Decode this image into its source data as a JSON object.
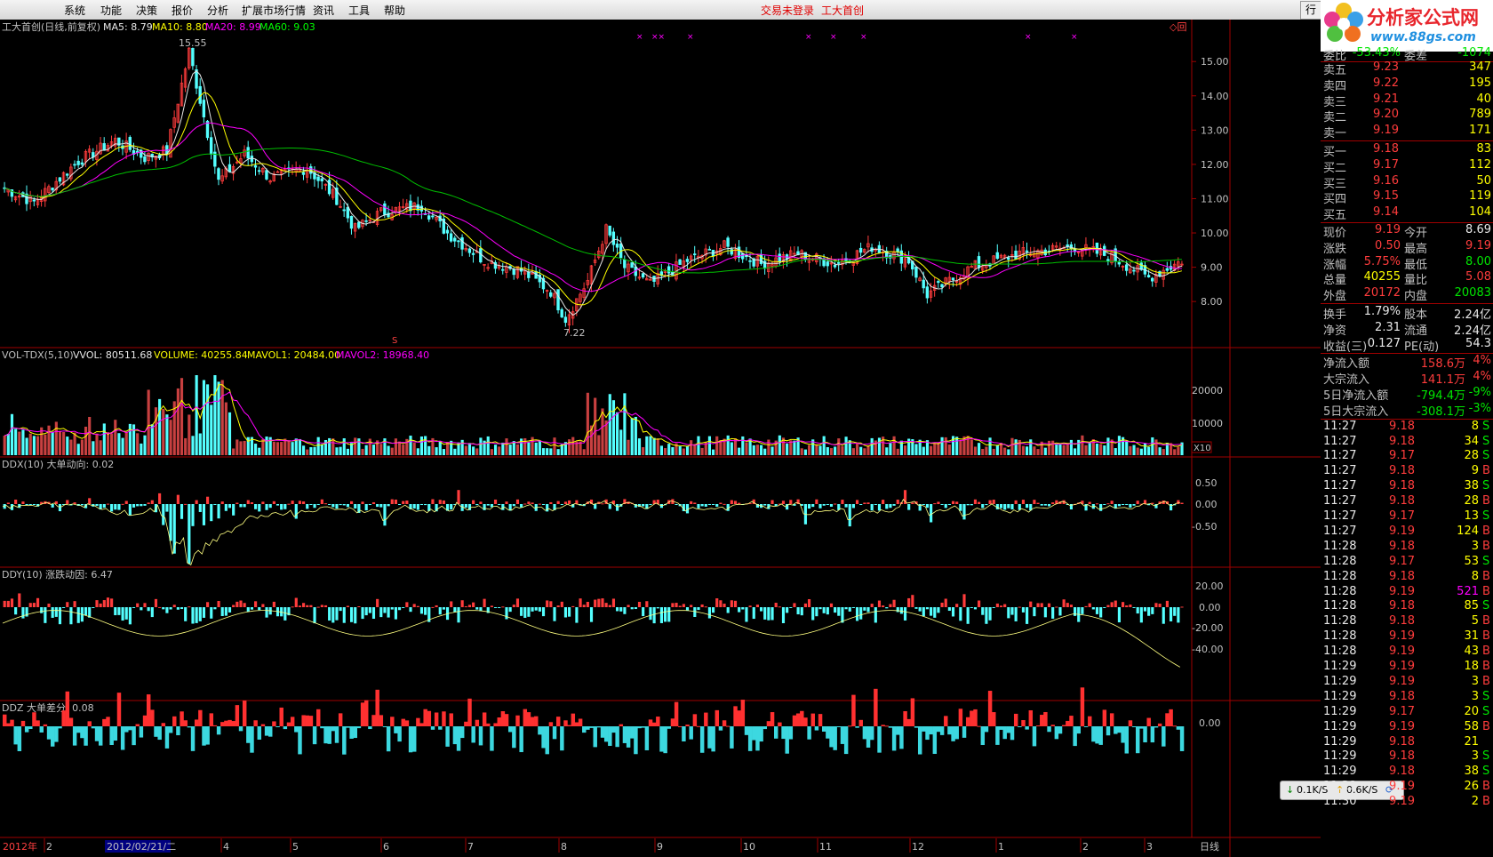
{
  "menu": {
    "items": [
      "系统",
      "功能",
      "决策",
      "报价",
      "分析",
      "扩展市场行情",
      "资讯",
      "工具",
      "帮助"
    ],
    "status": [
      "交易未登录",
      "工大首创"
    ],
    "right_button": "行"
  },
  "logo": {
    "title": "分析家公式网",
    "url": "www.88gs.com"
  },
  "main_panel": {
    "legend": {
      "name": "工大首创(日线,前复权)",
      "ma5": "MA5: 8.79",
      "ma10": "MA10: 8.80",
      "ma20": "MA20: 8.99",
      "ma60": "MA60: 9.03"
    },
    "high_label": "15.55",
    "low_label": "7.22",
    "yticks": [
      "15.00",
      "14.00",
      "13.00",
      "12.00",
      "11.00",
      "10.00",
      "9.00",
      "8.00"
    ]
  },
  "vol_panel": {
    "legend": {
      "name": "VOL-TDX(5,10)",
      "vvol": "VVOL: 80511.68",
      "volume": "VOLUME: 40255.84",
      "mavol1": "MAVOL1: 20484.00",
      "mavol2": "MAVOL2: 18968.40"
    },
    "yticks": [
      "20000",
      "10000"
    ],
    "unit": "X10"
  },
  "ddx_panel": {
    "legend": "DDX(10) 大单动向: 0.02",
    "yticks": [
      "0.50",
      "0.00",
      "-0.50"
    ]
  },
  "ddy_panel": {
    "legend": "DDY(10) 涨跌动因: 6.47",
    "yticks": [
      "20.00",
      "0.00",
      "-20.00",
      "-40.00"
    ]
  },
  "ddz_panel": {
    "legend": "DDZ 大单差分: 0.08",
    "yticks": [
      "0.00"
    ]
  },
  "axis": {
    "year": "2012年",
    "date_box": "2012/02/21/二",
    "months": [
      "2",
      "4",
      "5",
      "6",
      "7",
      "8",
      "9",
      "10",
      "11",
      "12",
      "1",
      "2",
      "3"
    ],
    "period": "日线"
  },
  "speed": {
    "down": "0.1K/S",
    "up": "0.6K/S"
  },
  "quote": {
    "weibi": {
      "label": "委比",
      "value": "-53.43%",
      "label2": "委差",
      "value2": "-1074"
    },
    "sell": [
      {
        "label": "卖五",
        "price": "9.23",
        "vol": "347"
      },
      {
        "label": "卖四",
        "price": "9.22",
        "vol": "195"
      },
      {
        "label": "卖三",
        "price": "9.21",
        "vol": "40"
      },
      {
        "label": "卖二",
        "price": "9.20",
        "vol": "789"
      },
      {
        "label": "卖一",
        "price": "9.19",
        "vol": "171"
      }
    ],
    "buy": [
      {
        "label": "买一",
        "price": "9.18",
        "vol": "83"
      },
      {
        "label": "买二",
        "price": "9.17",
        "vol": "112"
      },
      {
        "label": "买三",
        "price": "9.16",
        "vol": "50"
      },
      {
        "label": "买四",
        "price": "9.15",
        "vol": "119"
      },
      {
        "label": "买五",
        "price": "9.14",
        "vol": "104"
      }
    ],
    "stats": [
      {
        "l1": "现价",
        "v1": "9.19",
        "l2": "今开",
        "v2": "8.69",
        "c1": "red",
        "c2": "wht"
      },
      {
        "l1": "涨跌",
        "v1": "0.50",
        "l2": "最高",
        "v2": "9.19",
        "c1": "red",
        "c2": "red"
      },
      {
        "l1": "涨幅",
        "v1": "5.75%",
        "l2": "最低",
        "v2": "8.00",
        "c1": "red",
        "c2": "grn"
      },
      {
        "l1": "总量",
        "v1": "40255",
        "l2": "量比",
        "v2": "5.08",
        "c1": "yel",
        "c2": "red"
      },
      {
        "l1": "外盘",
        "v1": "20172",
        "l2": "内盘",
        "v2": "20083",
        "c1": "red",
        "c2": "grn"
      }
    ],
    "stats2": [
      {
        "l1": "换手",
        "v1": "1.79%",
        "l2": "股本",
        "v2": "2.24亿"
      },
      {
        "l1": "净资",
        "v1": "2.31",
        "l2": "流通",
        "v2": "2.24亿"
      },
      {
        "l1": "收益(三)",
        "v1": "0.127",
        "l2": "PE(动)",
        "v2": "54.3"
      }
    ],
    "flows": [
      {
        "label": "净流入额",
        "value": "158.6万",
        "pct": "4%",
        "color": "red"
      },
      {
        "label": "大宗流入",
        "value": "141.1万",
        "pct": "4%",
        "color": "red"
      },
      {
        "label": "5日净流入额",
        "value": "-794.4万",
        "pct": "-9%",
        "color": "grn"
      },
      {
        "label": "5日大宗流入",
        "value": "-308.1万",
        "pct": "-3%",
        "color": "grn"
      }
    ],
    "ticks": [
      {
        "t": "11:27",
        "p": "9.18",
        "v": "8",
        "d": "S"
      },
      {
        "t": "11:27",
        "p": "9.18",
        "v": "34",
        "d": "S"
      },
      {
        "t": "11:27",
        "p": "9.17",
        "v": "28",
        "d": "S"
      },
      {
        "t": "11:27",
        "p": "9.18",
        "v": "9",
        "d": "B"
      },
      {
        "t": "11:27",
        "p": "9.18",
        "v": "38",
        "d": "S"
      },
      {
        "t": "11:27",
        "p": "9.18",
        "v": "28",
        "d": "B"
      },
      {
        "t": "11:27",
        "p": "9.17",
        "v": "13",
        "d": "S"
      },
      {
        "t": "11:27",
        "p": "9.19",
        "v": "124",
        "d": "B"
      },
      {
        "t": "11:28",
        "p": "9.18",
        "v": "3",
        "d": "B"
      },
      {
        "t": "11:28",
        "p": "9.17",
        "v": "53",
        "d": "S"
      },
      {
        "t": "11:28",
        "p": "9.18",
        "v": "8",
        "d": "B"
      },
      {
        "t": "11:28",
        "p": "9.19",
        "v": "521",
        "d": "B",
        "vm": true
      },
      {
        "t": "11:28",
        "p": "9.18",
        "v": "85",
        "d": "S"
      },
      {
        "t": "11:28",
        "p": "9.18",
        "v": "5",
        "d": "B"
      },
      {
        "t": "11:28",
        "p": "9.19",
        "v": "31",
        "d": "B"
      },
      {
        "t": "11:28",
        "p": "9.19",
        "v": "43",
        "d": "B"
      },
      {
        "t": "11:29",
        "p": "9.19",
        "v": "18",
        "d": "B"
      },
      {
        "t": "11:29",
        "p": "9.19",
        "v": "3",
        "d": "B"
      },
      {
        "t": "11:29",
        "p": "9.18",
        "v": "3",
        "d": "S"
      },
      {
        "t": "11:29",
        "p": "9.17",
        "v": "20",
        "d": "S"
      },
      {
        "t": "11:29",
        "p": "9.19",
        "v": "58",
        "d": "B"
      },
      {
        "t": "11:29",
        "p": "9.18",
        "v": "21",
        "d": ""
      },
      {
        "t": "11:29",
        "p": "9.18",
        "v": "3",
        "d": "S"
      },
      {
        "t": "11:29",
        "p": "9.18",
        "v": "38",
        "d": "S"
      },
      {
        "t": "11:29",
        "p": "9.19",
        "v": "26",
        "d": "B"
      },
      {
        "t": "11:30",
        "p": "9.19",
        "v": "2",
        "d": "B"
      }
    ]
  }
}
